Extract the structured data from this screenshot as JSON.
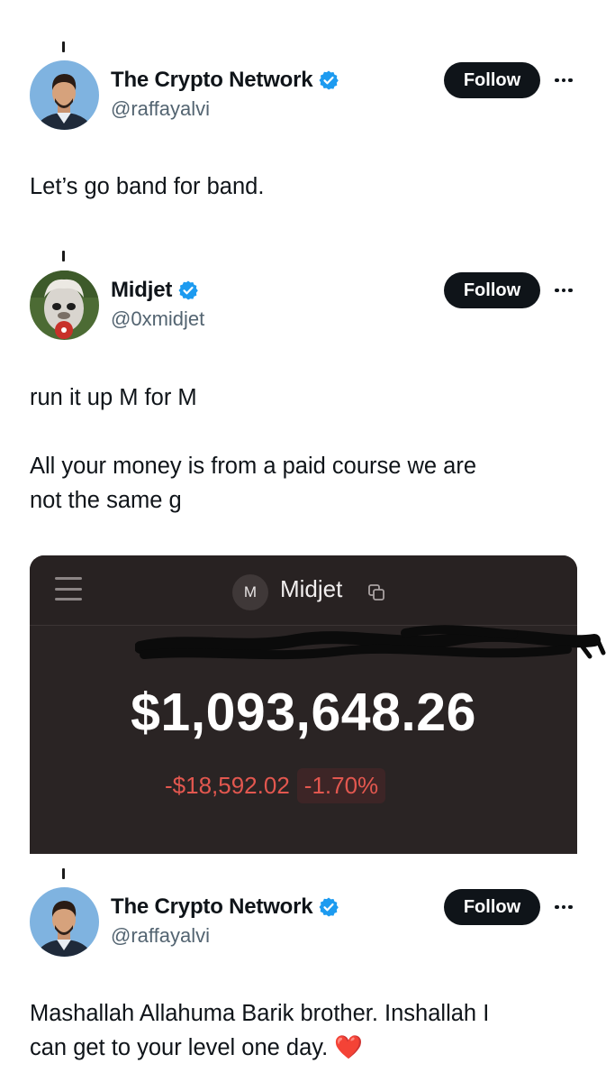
{
  "tweets": [
    {
      "name": "The Crypto Network",
      "handle": "@raffayalvi",
      "follow_label": "Follow",
      "text": "Let’s go band for band."
    },
    {
      "name": "Midjet",
      "handle": "@0xmidjet",
      "follow_label": "Follow",
      "text": "run it up M for M\n\nAll your money is from a paid course we are\nnot the same g"
    },
    {
      "name": "The Crypto Network",
      "handle": "@raffayalvi",
      "follow_label": "Follow",
      "text": "Mashallah Allahuma Barik brother. Inshallah I\ncan get to your level one day. ❤️"
    }
  ],
  "wallet_card": {
    "account_initial": "M",
    "account_name": "Midjet",
    "balance": "$1,093,648.26",
    "change_amount": "-$18,592.02",
    "change_percent": "-1.70%"
  },
  "icons": {
    "verified": "verified-badge-icon",
    "more": "more-options-icon",
    "menu": "hamburger-menu-icon",
    "copy": "copy-icon"
  },
  "colors": {
    "verified_blue": "#1d9bf0",
    "follow_button": "#0f1419",
    "negative": "#e2574f",
    "card_bg": "#2a2424"
  }
}
